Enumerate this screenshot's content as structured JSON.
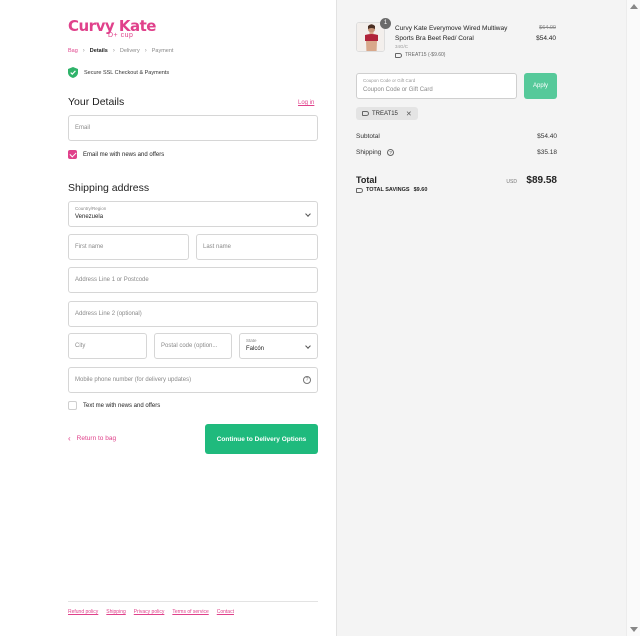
{
  "brand": {
    "name": "Curvy Kate",
    "tagline": "D+ cup"
  },
  "breadcrumb": {
    "bag": "Bag",
    "details": "Details",
    "delivery": "Delivery",
    "payment": "Payment"
  },
  "secure_text": "Secure SSL Checkout & Payments",
  "your_details": {
    "title": "Your Details",
    "login_label": "Log in",
    "email_placeholder": "Email",
    "email_news_label": "Email me with news and offers",
    "email_news_checked": true
  },
  "shipping": {
    "title": "Shipping address",
    "country_label": "Country/Region",
    "country_value": "Venezuela",
    "first_name_placeholder": "First name",
    "last_name_placeholder": "Last name",
    "address1_placeholder": "Address Line 1 or Postcode",
    "address2_placeholder": "Address Line 2 (optional)",
    "city_placeholder": "City",
    "postal_placeholder": "Postal code (option...",
    "state_label": "State",
    "state_value": "Falcón",
    "phone_placeholder": "Mobile phone number (for delivery updates)",
    "text_news_label": "Text me with news and offers",
    "text_news_checked": false
  },
  "actions": {
    "return_label": "Return to bag",
    "continue_label": "Continue to Delivery Options"
  },
  "footer_links": [
    "Refund policy",
    "Shipping",
    "Privacy policy",
    "Terms of service",
    "Contact"
  ],
  "order": {
    "item": {
      "quantity": "1",
      "name": "Curvy Kate Everymove Wired Multiway Sports Bra Beet Red/ Coral",
      "variant": "34G/C",
      "discount": "TREAT15 (-$9.60)",
      "price_original": "$64.00",
      "price": "$54.40"
    },
    "coupon_label": "Coupon Code or Gift Card",
    "coupon_placeholder": "Coupon Code or Gift Card",
    "coupon_apply_label": "Apply",
    "applied_code": "TREAT15",
    "subtotal_label": "Subtotal",
    "subtotal_value": "$54.40",
    "shipping_label": "Shipping",
    "shipping_value": "$35.18",
    "total_label": "Total",
    "total_currency": "USD",
    "total_value": "$89.58",
    "savings_label": "TOTAL SAVINGS",
    "savings_value": "$9.60"
  },
  "colors": {
    "brand": "#e0418b",
    "primary_button": "#1fba7d",
    "apply_button": "#56c99a",
    "shield": "#2fb36a"
  }
}
